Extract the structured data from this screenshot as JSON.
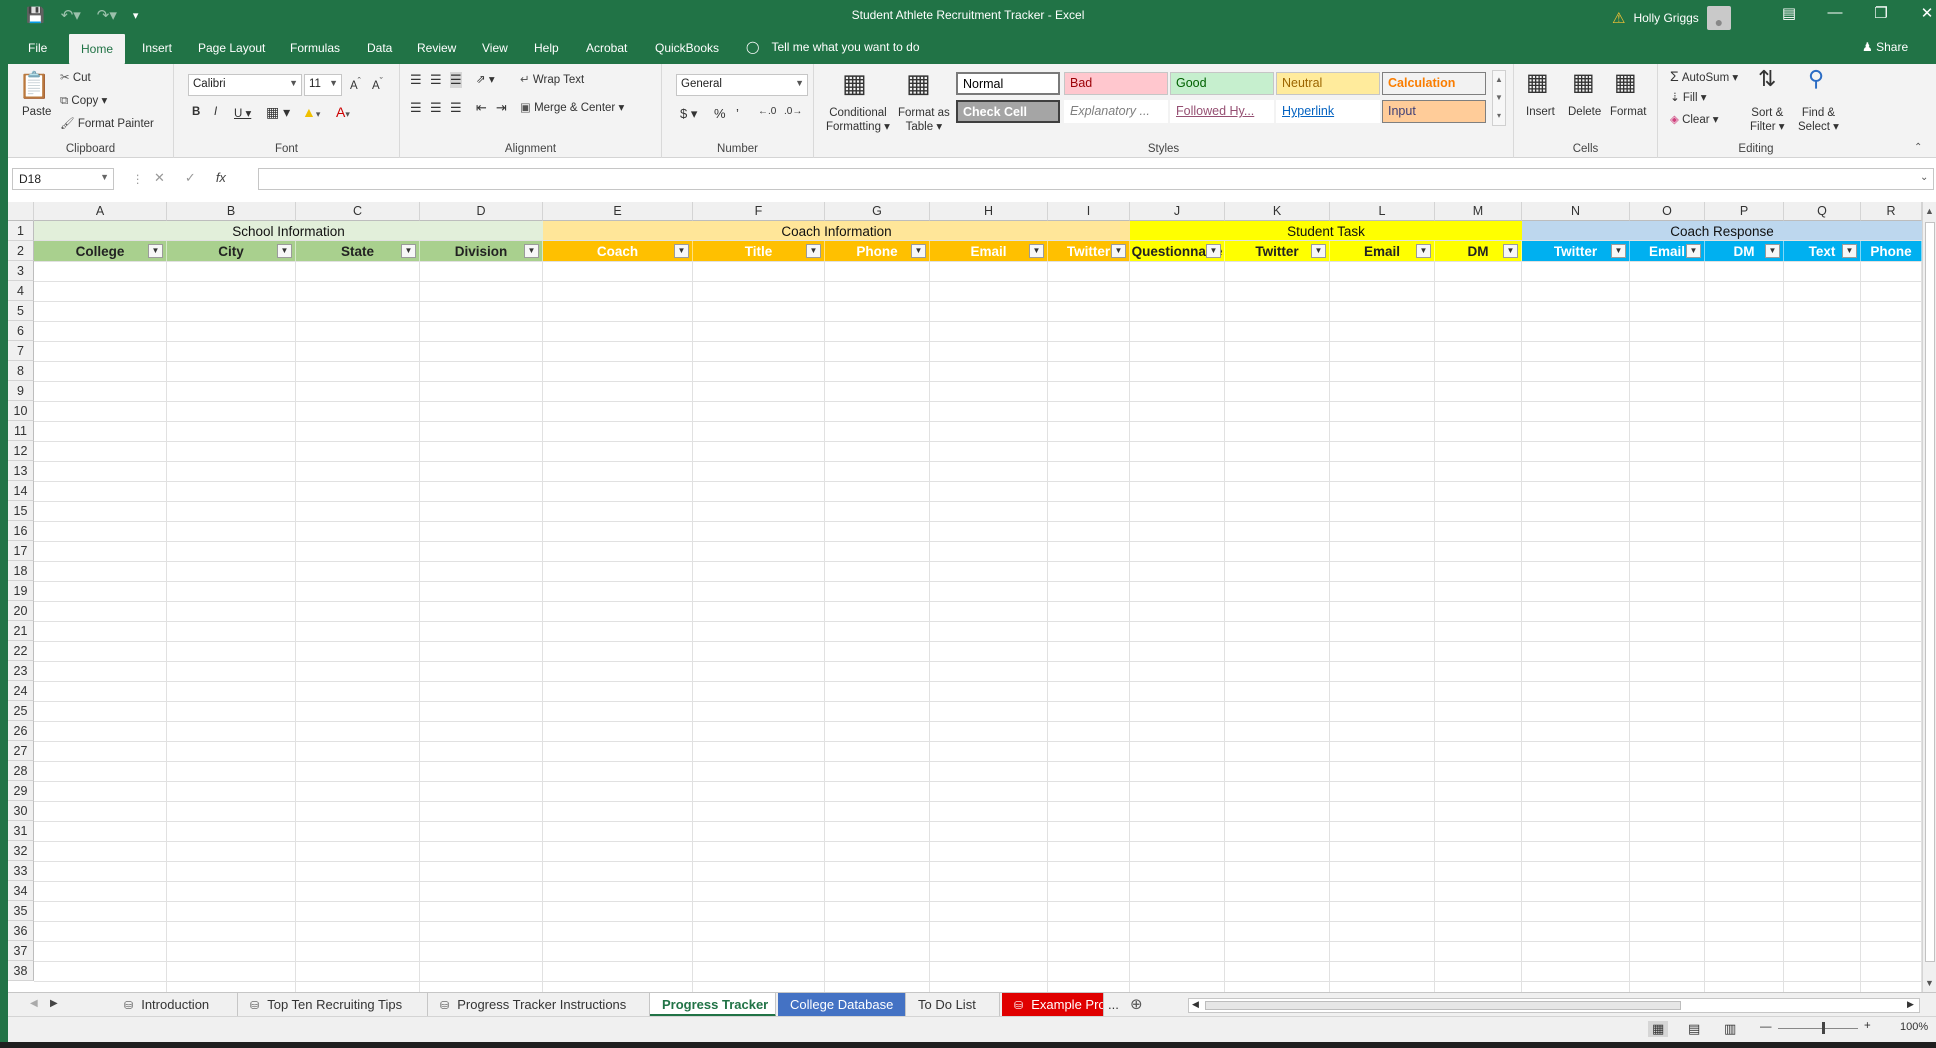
{
  "titlebar": {
    "title": "Student Athlete Recruitment Tracker  -  Excel",
    "user": "Holly Griggs"
  },
  "menu": {
    "tabs": [
      "File",
      "Home",
      "Insert",
      "Page Layout",
      "Formulas",
      "Data",
      "Review",
      "View",
      "Help",
      "Acrobat",
      "QuickBooks"
    ],
    "active": "Home",
    "tell": "Tell me what you want to do",
    "share": "Share"
  },
  "ribbon": {
    "clipboard": {
      "label": "Clipboard",
      "paste": "Paste",
      "cut": "Cut",
      "copy": "Copy",
      "format_painter": "Format Painter"
    },
    "font": {
      "label": "Font",
      "name": "Calibri",
      "size": "11"
    },
    "alignment": {
      "label": "Alignment",
      "wrap": "Wrap Text",
      "merge": "Merge & Center"
    },
    "number": {
      "label": "Number",
      "format": "General"
    },
    "styles": {
      "label": "Styles",
      "conditional": "Conditional",
      "conditional2": "Formatting",
      "format_table": "Format as",
      "format_table2": "Table",
      "cells": [
        {
          "text": "Normal",
          "bg": "#ffffff",
          "fg": "#000000"
        },
        {
          "text": "Bad",
          "bg": "#ffc7ce",
          "fg": "#9c0006"
        },
        {
          "text": "Good",
          "bg": "#c6efce",
          "fg": "#006100"
        },
        {
          "text": "Neutral",
          "bg": "#ffeb9c",
          "fg": "#9c6500"
        },
        {
          "text": "Calculation",
          "bg": "#f2f2f2",
          "fg": "#fa7d00"
        },
        {
          "text": "Check Cell",
          "bg": "#a5a5a5",
          "fg": "#ffffff"
        },
        {
          "text": "Explanatory ...",
          "bg": "#ffffff",
          "fg": "#7f7f7f"
        },
        {
          "text": "Followed Hy...",
          "bg": "#ffffff",
          "fg": "#954f72"
        },
        {
          "text": "Hyperlink",
          "bg": "#ffffff",
          "fg": "#0563c1"
        },
        {
          "text": "Input",
          "bg": "#ffcc99",
          "fg": "#3f3f76"
        }
      ]
    },
    "cells": {
      "label": "Cells",
      "insert": "Insert",
      "delete": "Delete",
      "format": "Format"
    },
    "editing": {
      "label": "Editing",
      "autosum": "AutoSum",
      "fill": "Fill",
      "clear": "Clear",
      "sort": "Sort &",
      "sort2": "Filter",
      "find": "Find &",
      "find2": "Select"
    }
  },
  "formula": {
    "namebox": "D18",
    "fx": "fx",
    "value": ""
  },
  "columns": [
    "A",
    "B",
    "C",
    "D",
    "E",
    "F",
    "G",
    "H",
    "I",
    "J",
    "K",
    "L",
    "M",
    "N",
    "O",
    "P",
    "Q",
    "R"
  ],
  "groups": [
    {
      "title": "School Information",
      "bg": "#e2efda"
    },
    {
      "title": "Coach Information",
      "bg": "#ffe699"
    },
    {
      "title": "Student Task",
      "bg": "#ffff00"
    },
    {
      "title": "Coach Response",
      "bg": "#bdd7ee"
    }
  ],
  "headers": [
    "College",
    "City",
    "State",
    "Division",
    "Coach",
    "Title",
    "Phone",
    "Email",
    "Twitter",
    "Questionnaire",
    "Twitter",
    "Email",
    "DM",
    "Twitter",
    "Email",
    "DM",
    "Text",
    "Phone"
  ],
  "header_colors": {
    "school": "#a9d08e",
    "coach": "#ffc000",
    "task": "#ffff00",
    "response": "#00b0f0"
  },
  "sheets": [
    "Introduction",
    "Top Ten Recruiting Tips",
    "Progress Tracker Instructions",
    "Progress Tracker",
    "College Database",
    "To Do List",
    "Example Pro"
  ],
  "active_sheet": "Progress Tracker",
  "status": {
    "zoom": "100%"
  }
}
